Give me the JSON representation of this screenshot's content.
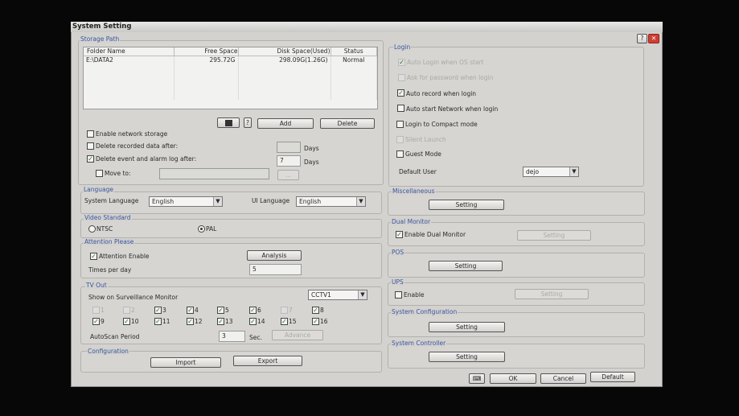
{
  "window": {
    "title": "System Setting",
    "help": "?",
    "close": "✕"
  },
  "storage": {
    "label": "Storage Path",
    "columns": [
      "Folder Name",
      "Free Space",
      "Disk Space(Used)",
      "Status"
    ],
    "rows": [
      [
        "E:\\DATA2",
        "295.72G",
        "298.09G(1.26G)",
        "Normal"
      ]
    ],
    "help": "?",
    "add": "Add",
    "delete": "Delete",
    "enable_network": "Enable network storage",
    "delete_recorded": "Delete recorded data after:",
    "delete_recorded_value": "",
    "days1": "Days",
    "delete_event": "Delete event and alarm log after:",
    "delete_event_value": "7",
    "days2": "Days",
    "move_to": "Move to:",
    "browse": "..."
  },
  "language": {
    "label": "Language",
    "system": "System Language",
    "system_value": "English",
    "ui": "UI Language",
    "ui_value": "English"
  },
  "video": {
    "label": "Video Standard",
    "ntsc": "NTSC",
    "pal": "PAL",
    "selected": "PAL"
  },
  "attention": {
    "label": "Attention Please",
    "enable": "Attention Enable",
    "analysis": "Analysis",
    "times": "Times per day",
    "times_value": "5"
  },
  "tvout": {
    "label": "TV Out",
    "show": "Show on Surveillance Monitor",
    "monitor": "CCTV1",
    "channels": [
      {
        "n": "1",
        "checked": false,
        "disabled": true
      },
      {
        "n": "2",
        "checked": false,
        "disabled": true
      },
      {
        "n": "3",
        "checked": true
      },
      {
        "n": "4",
        "checked": true
      },
      {
        "n": "5",
        "checked": true
      },
      {
        "n": "6",
        "checked": true
      },
      {
        "n": "7",
        "checked": false,
        "disabled": true
      },
      {
        "n": "8",
        "checked": true
      },
      {
        "n": "9",
        "checked": true
      },
      {
        "n": "10",
        "checked": true
      },
      {
        "n": "11",
        "checked": true
      },
      {
        "n": "12",
        "checked": true
      },
      {
        "n": "13",
        "checked": true
      },
      {
        "n": "14",
        "checked": true
      },
      {
        "n": "15",
        "checked": true
      },
      {
        "n": "16",
        "checked": true
      }
    ],
    "autoscan": "AutoScan Period",
    "autoscan_value": "3",
    "sec": "Sec.",
    "advance": "Advance"
  },
  "config": {
    "label": "Configuration",
    "import": "Import",
    "export": "Export"
  },
  "login": {
    "label": "Login",
    "items": [
      "Auto Login when OS start",
      "Ask for password when login",
      "Auto record when login",
      "Auto start Network when login",
      "Login to Compact mode",
      "Silent Launch",
      "Guest Mode"
    ],
    "default_user": "Default User",
    "default_user_value": "dejo"
  },
  "misc": {
    "label": "Miscellaneous",
    "setting": "Setting"
  },
  "dual": {
    "label": "Dual Monitor",
    "enable": "Enable Dual Monitor",
    "setting": "Setting"
  },
  "pos": {
    "label": "POS",
    "setting": "Setting"
  },
  "ups": {
    "label": "UPS",
    "enable": "Enable",
    "setting": "Setting"
  },
  "sysconf": {
    "label": "System Configuration",
    "setting": "Setting"
  },
  "sysctrl": {
    "label": "System Controller",
    "setting": "Setting"
  },
  "footer": {
    "ok": "OK",
    "cancel": "Cancel",
    "default": "Default"
  }
}
